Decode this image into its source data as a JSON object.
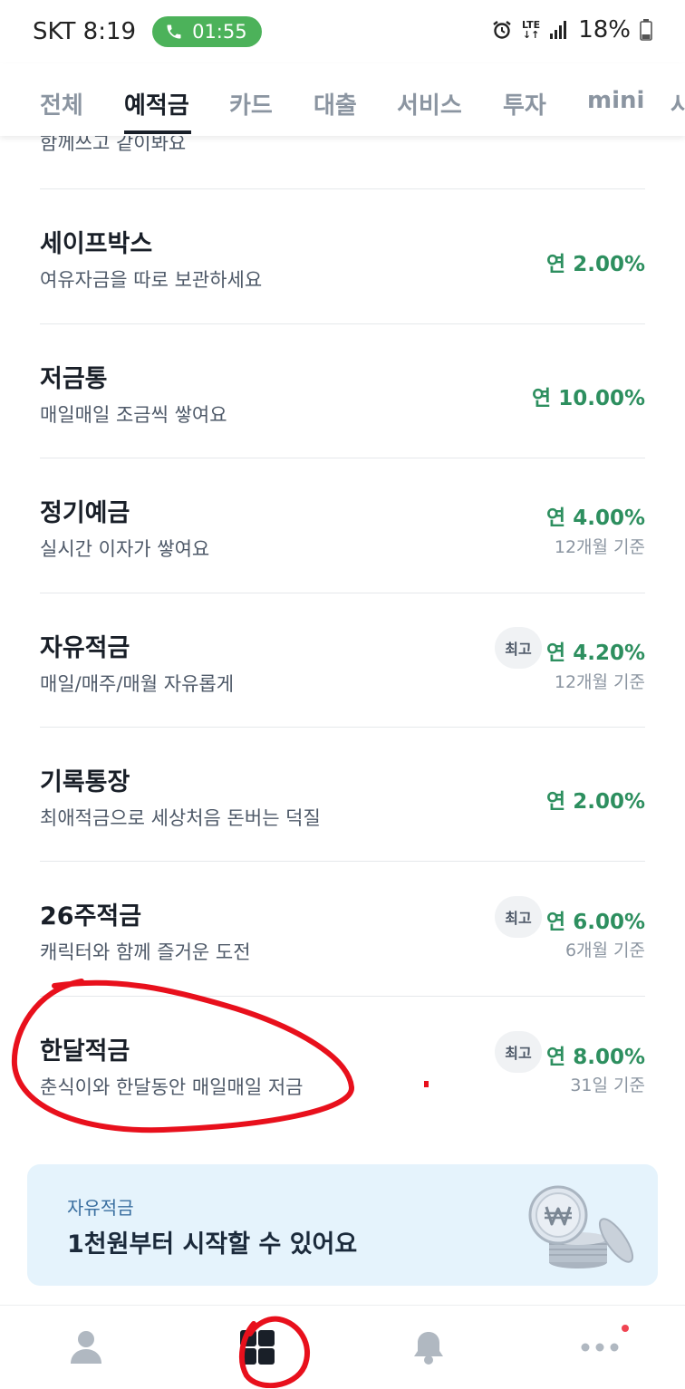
{
  "status_bar": {
    "carrier_time": "SKT 8:19",
    "call_timer": "01:55",
    "network": "LTE",
    "battery": "18%"
  },
  "tabs": [
    {
      "label": "전체",
      "active": false
    },
    {
      "label": "예적금",
      "active": true
    },
    {
      "label": "카드",
      "active": false
    },
    {
      "label": "대출",
      "active": false
    },
    {
      "label": "서비스",
      "active": false
    },
    {
      "label": "투자",
      "active": false
    },
    {
      "label": "mini",
      "active": false
    },
    {
      "label": "사",
      "active": false
    }
  ],
  "partial_item": {
    "subtitle": "함께쓰고 같이봐요"
  },
  "products": [
    {
      "title": "세이프박스",
      "subtitle": "여유자금을 따로 보관하세요",
      "rate": "연 2.00%",
      "term": "",
      "badge": ""
    },
    {
      "title": "저금통",
      "subtitle": "매일매일 조금씩 쌓여요",
      "rate": "연 10.00%",
      "term": "",
      "badge": ""
    },
    {
      "title": "정기예금",
      "subtitle": "실시간 이자가 쌓여요",
      "rate": "연 4.00%",
      "term": "12개월 기준",
      "badge": ""
    },
    {
      "title": "자유적금",
      "subtitle": "매일/매주/매월 자유롭게",
      "rate": "연 4.20%",
      "term": "12개월 기준",
      "badge": "최고"
    },
    {
      "title": "기록통장",
      "subtitle": "최애적금으로 세상처음 돈버는 덕질",
      "rate": "연 2.00%",
      "term": "",
      "badge": ""
    },
    {
      "title": "26주적금",
      "subtitle": "캐릭터와 함께 즐거운 도전",
      "rate": "연 6.00%",
      "term": "6개월 기준",
      "badge": "최고"
    },
    {
      "title": "한달적금",
      "subtitle": "춘식이와 한달동안 매일매일 저금",
      "rate": "연 8.00%",
      "term": "31일 기준",
      "badge": "최고"
    }
  ],
  "promo": {
    "label": "자유적금",
    "title": "1천원부터 시작할 수 있어요",
    "icon": "won-coin-stack-icon"
  },
  "bottom_nav": [
    {
      "icon": "person-icon"
    },
    {
      "icon": "grid-icon"
    },
    {
      "icon": "bell-icon"
    },
    {
      "icon": "more-icon"
    }
  ],
  "colors": {
    "rate_green": "#2d8f5f",
    "annotation_red": "#e8101c",
    "call_green": "#4cb25a",
    "promo_bg": "#e5f3fc"
  }
}
